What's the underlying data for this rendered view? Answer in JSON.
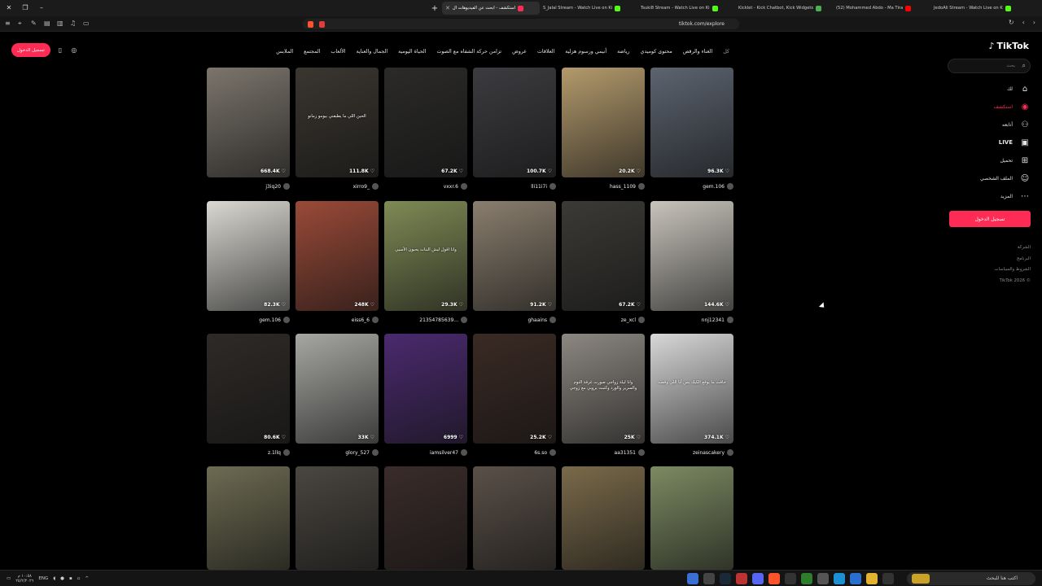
{
  "browser": {
    "tabs": [
      {
        "label": "استكشف - ابحث عن الفيديوهات ال",
        "active": true,
        "fav": "#fe2c55"
      },
      {
        "label": "S_Jalal Stream - Watch Live on Ki",
        "active": false,
        "fav": "#53fc18"
      },
      {
        "label": "Tsuki8 Stream - Watch Live on Ki",
        "active": false,
        "fav": "#53fc18"
      },
      {
        "label": "Kicklet - Kick Chatbot, Kick Widgets",
        "active": false,
        "fav": "#4caf50"
      },
      {
        "label": "(52) Mohammed Abdo - Ma Tira",
        "active": false,
        "fav": "#ff0000"
      },
      {
        "label": "JedoAli Stream - Watch Live on K",
        "active": false,
        "fav": "#53fc18"
      }
    ],
    "url": "tiktok.com/explore"
  },
  "sidebar": {
    "logo": "TikTok",
    "search_placeholder": "بحث",
    "nav": [
      {
        "label": "لك",
        "icon": "home-icon",
        "glyph": "⌂",
        "active": false,
        "live": false
      },
      {
        "label": "استكشف",
        "icon": "compass-icon",
        "glyph": "◉",
        "active": true,
        "live": false
      },
      {
        "label": "أتابعه",
        "icon": "user-plus-icon",
        "glyph": "⚇",
        "active": false,
        "live": false
      },
      {
        "label": "LIVE",
        "icon": "live-icon",
        "glyph": "▣",
        "active": false,
        "live": true
      },
      {
        "label": "تحميل",
        "icon": "upload-icon",
        "glyph": "⊞",
        "active": false,
        "live": false
      },
      {
        "label": "الملف الشخصي",
        "icon": "profile-icon",
        "glyph": "☺",
        "active": false,
        "live": false
      },
      {
        "label": "المزيد",
        "icon": "more-icon",
        "glyph": "⋯",
        "active": false,
        "live": false
      }
    ],
    "login": "تسجيل الدخول",
    "footer": [
      "الشركة",
      "البرنامج",
      "الشروط والسياسات",
      "TikTok 2026 ©"
    ]
  },
  "topleft": {
    "login": "تسجيل الدخول"
  },
  "categories": [
    "كل",
    "الغناء والرقص",
    "محتوى كوميدي",
    "رياضة",
    "أنيمي ورسوم هزلية",
    "العلاقات",
    "عروض",
    "تزامن حركة الشفاه مع الصوت",
    "الحياة اليومية",
    "الجمال والعناية",
    "الألعاب",
    "المجتمع",
    "الملابس"
  ],
  "videos": [
    {
      "views": "668.4K",
      "user": "j3iq20",
      "cap": "",
      "bg": "#7b756c"
    },
    {
      "views": "111.8K",
      "user": "xirro9_",
      "cap": "الحين اللي ما يطبقني بيومو زمانو",
      "bg": "#3a3630"
    },
    {
      "views": "67.2K",
      "user": "vxxr.6",
      "cap": "",
      "bg": "#2b2a29"
    },
    {
      "views": "100.7K",
      "user": "lli11i7i",
      "cap": "",
      "bg": "#3c3c40"
    },
    {
      "views": "20.2K",
      "user": "hass_1109",
      "cap": "",
      "bg": "#b39a6c"
    },
    {
      "views": "96.3K",
      "user": "gem.106",
      "cap": "",
      "bg": "#5c6470"
    },
    {
      "views": "82.3K",
      "user": "gem.106",
      "cap": "",
      "bg": "#d9d8d2"
    },
    {
      "views": "248K",
      "user": "eiss6_6",
      "cap": "",
      "bg": "#9a4a38"
    },
    {
      "views": "29.3K",
      "user": "21354785639...",
      "cap": "وانا اقول ليش البنات يحبون الأسيي",
      "bg": "#7f8a55"
    },
    {
      "views": "91.2K",
      "user": "ghaains",
      "cap": "",
      "bg": "#8a7e6e"
    },
    {
      "views": "67.2K",
      "user": "ze_xcl",
      "cap": "",
      "bg": "#3b3a36"
    },
    {
      "views": "144.6K",
      "user": "nnj12341",
      "cap": "",
      "bg": "#c8c4bc"
    },
    {
      "views": "80.6K",
      "user": "z.1llq",
      "cap": "",
      "bg": "#2e2a27"
    },
    {
      "views": "33K",
      "user": "glory_527",
      "cap": "",
      "bg": "#a6a6a2"
    },
    {
      "views": "6999",
      "user": "iamsilver47",
      "cap": "",
      "bg": "#4a2a6e"
    },
    {
      "views": "25.2K",
      "user": "6s.so",
      "cap": "",
      "bg": "#3a2a24"
    },
    {
      "views": "25K",
      "user": "aa31351",
      "cap": "وانا ليلة زواجي صورت غرفة النوم والسرير والورد وكتبت بروبي مع زوجي",
      "bg": "#8c8781"
    },
    {
      "views": "374.1K",
      "user": "zeinascakery",
      "cap": "خافت ما يوقع الكيك بس أنا اللي وقعت",
      "bg": "#d8d8d8"
    },
    {
      "views": "",
      "user": "",
      "cap": "",
      "bg": "#6d6b52"
    },
    {
      "views": "",
      "user": "",
      "cap": "",
      "bg": "#4a4640"
    },
    {
      "views": "",
      "user": "",
      "cap": "",
      "bg": "#3a2c2a"
    },
    {
      "views": "",
      "user": "",
      "cap": "",
      "bg": "#5a5048"
    },
    {
      "views": "",
      "user": "",
      "cap": "",
      "bg": "#7a6a4a"
    },
    {
      "views": "",
      "user": "",
      "cap": "",
      "bg": "#7c8a62"
    }
  ],
  "taskbar": {
    "search_placeholder": "اكتب هنا للبحث",
    "lang": "ENG",
    "time": "١٠:٥٨ م",
    "date": "٢٥/٢/٢٠٢٦"
  },
  "colors": {
    "accent": "#fe2c55",
    "bg": "#000000"
  }
}
